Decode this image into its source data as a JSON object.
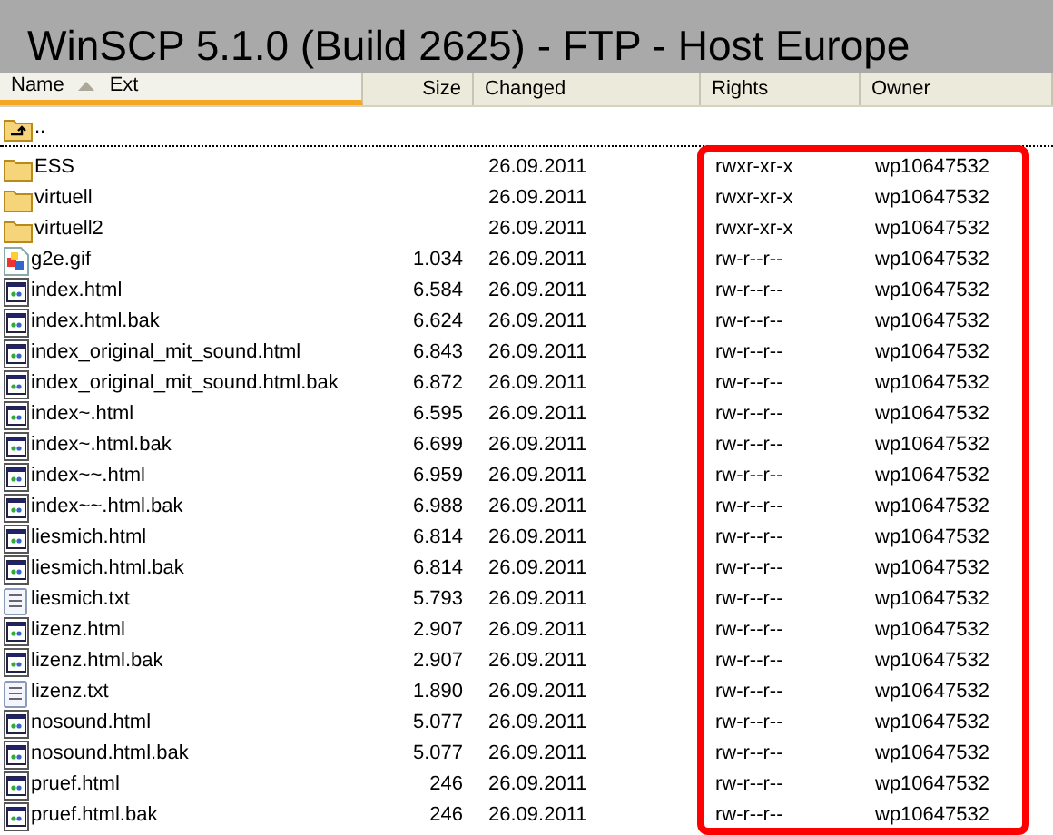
{
  "window": {
    "title": "WinSCP 5.1.0 (Build 2625) - FTP - Host Europe"
  },
  "columns": [
    {
      "label": "Name",
      "secondary_label": "Ext",
      "sorted": true
    },
    {
      "label": "Size",
      "sorted": false
    },
    {
      "label": "Changed",
      "sorted": false
    },
    {
      "label": "Rights",
      "sorted": false
    },
    {
      "label": "Owner",
      "sorted": false
    }
  ],
  "rows": [
    {
      "kind": "parent",
      "name": "..",
      "focused": true
    },
    {
      "kind": "folder",
      "name": "ESS",
      "changed": "26.09.2011",
      "rights": "rwxr-xr-x",
      "owner": "wp10647532",
      "focused": false
    },
    {
      "kind": "folder",
      "name": "virtuell",
      "changed": "26.09.2011",
      "rights": "rwxr-xr-x",
      "owner": "wp10647532",
      "focused": false
    },
    {
      "kind": "folder",
      "name": "virtuell2",
      "changed": "26.09.2011",
      "rights": "rwxr-xr-x",
      "owner": "wp10647532",
      "focused": false
    },
    {
      "kind": "image",
      "name": "g2e.gif",
      "size": "1.034",
      "changed": "26.09.2011",
      "rights": "rw-r--r--",
      "owner": "wp10647532",
      "focused": false
    },
    {
      "kind": "html",
      "name": "index.html",
      "size": "6.584",
      "changed": "26.09.2011",
      "rights": "rw-r--r--",
      "owner": "wp10647532",
      "focused": false
    },
    {
      "kind": "html",
      "name": "index.html.bak",
      "size": "6.624",
      "changed": "26.09.2011",
      "rights": "rw-r--r--",
      "owner": "wp10647532",
      "focused": false
    },
    {
      "kind": "html",
      "name": "index_original_mit_sound.html",
      "size": "6.843",
      "changed": "26.09.2011",
      "rights": "rw-r--r--",
      "owner": "wp10647532",
      "focused": false
    },
    {
      "kind": "html",
      "name": "index_original_mit_sound.html.bak",
      "size": "6.872",
      "changed": "26.09.2011",
      "rights": "rw-r--r--",
      "owner": "wp10647532",
      "focused": false
    },
    {
      "kind": "html",
      "name": "index~.html",
      "size": "6.595",
      "changed": "26.09.2011",
      "rights": "rw-r--r--",
      "owner": "wp10647532",
      "focused": false
    },
    {
      "kind": "html",
      "name": "index~.html.bak",
      "size": "6.699",
      "changed": "26.09.2011",
      "rights": "rw-r--r--",
      "owner": "wp10647532",
      "focused": false
    },
    {
      "kind": "html",
      "name": "index~~.html",
      "size": "6.959",
      "changed": "26.09.2011",
      "rights": "rw-r--r--",
      "owner": "wp10647532",
      "focused": false
    },
    {
      "kind": "html",
      "name": "index~~.html.bak",
      "size": "6.988",
      "changed": "26.09.2011",
      "rights": "rw-r--r--",
      "owner": "wp10647532",
      "focused": false
    },
    {
      "kind": "html",
      "name": "liesmich.html",
      "size": "6.814",
      "changed": "26.09.2011",
      "rights": "rw-r--r--",
      "owner": "wp10647532",
      "focused": false
    },
    {
      "kind": "html",
      "name": "liesmich.html.bak",
      "size": "6.814",
      "changed": "26.09.2011",
      "rights": "rw-r--r--",
      "owner": "wp10647532",
      "focused": false
    },
    {
      "kind": "text",
      "name": "liesmich.txt",
      "size": "5.793",
      "changed": "26.09.2011",
      "rights": "rw-r--r--",
      "owner": "wp10647532",
      "focused": false
    },
    {
      "kind": "html",
      "name": "lizenz.html",
      "size": "2.907",
      "changed": "26.09.2011",
      "rights": "rw-r--r--",
      "owner": "wp10647532",
      "focused": false
    },
    {
      "kind": "html",
      "name": "lizenz.html.bak",
      "size": "2.907",
      "changed": "26.09.2011",
      "rights": "rw-r--r--",
      "owner": "wp10647532",
      "focused": false
    },
    {
      "kind": "text",
      "name": "lizenz.txt",
      "size": "1.890",
      "changed": "26.09.2011",
      "rights": "rw-r--r--",
      "owner": "wp10647532",
      "focused": false
    },
    {
      "kind": "html",
      "name": "nosound.html",
      "size": "5.077",
      "changed": "26.09.2011",
      "rights": "rw-r--r--",
      "owner": "wp10647532",
      "focused": false
    },
    {
      "kind": "html",
      "name": "nosound.html.bak",
      "size": "5.077",
      "changed": "26.09.2011",
      "rights": "rw-r--r--",
      "owner": "wp10647532",
      "focused": false
    },
    {
      "kind": "html",
      "name": "pruef.html",
      "size": "246",
      "changed": "26.09.2011",
      "rights": "rw-r--r--",
      "owner": "wp10647532",
      "focused": false
    },
    {
      "kind": "html",
      "name": "pruef.html.bak",
      "size": "246",
      "changed": "26.09.2011",
      "rights": "rw-r--r--",
      "owner": "wp10647532",
      "focused": false
    }
  ]
}
